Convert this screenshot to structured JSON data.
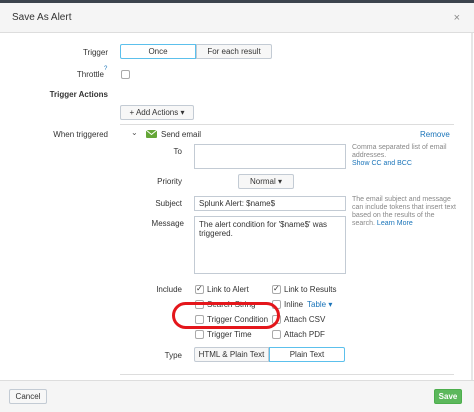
{
  "dialog": {
    "title": "Save As Alert",
    "close_label": "×"
  },
  "trigger": {
    "label": "Trigger",
    "options": [
      "Once",
      "For each result"
    ],
    "selected": "Once"
  },
  "throttle": {
    "label": "Throttle",
    "help_marker": "?"
  },
  "trigger_actions": {
    "heading": "Trigger Actions",
    "add_button": "+ Add Actions ▾"
  },
  "when_triggered": {
    "label": "When triggered",
    "action_name": "Send email",
    "remove_label": "Remove",
    "to": {
      "label": "To",
      "value": "",
      "help": "Comma separated list of email addresses.",
      "help_link": "Show CC and BCC"
    },
    "priority": {
      "label": "Priority",
      "value": "Normal ▾"
    },
    "subject": {
      "label": "Subject",
      "value": "Splunk Alert: $name$",
      "help": "The email subject and message can include tokens that insert text based on the results of the search.",
      "help_link": "Learn More"
    },
    "message": {
      "label": "Message",
      "value": "The alert condition for '$name$' was triggered."
    },
    "include": {
      "label": "Include",
      "items": [
        {
          "label": "Link to Alert",
          "checked": true
        },
        {
          "label": "Link to Results",
          "checked": true
        },
        {
          "label": "Search String",
          "checked": false
        },
        {
          "label": "Inline",
          "checked": false
        },
        {
          "label": "Trigger Condition",
          "checked": false
        },
        {
          "label": "Attach CSV",
          "checked": false
        },
        {
          "label": "Trigger Time",
          "checked": false
        },
        {
          "label": "Attach PDF",
          "checked": false
        }
      ],
      "inline_format": "Table ▾"
    },
    "type": {
      "label": "Type",
      "options": [
        "HTML & Plain Text",
        "Plain Text"
      ],
      "selected": "Plain Text"
    }
  },
  "footer": {
    "cancel_label": "Cancel",
    "save_label": "Save"
  },
  "colors": {
    "save_green": "#5cb85c",
    "link_blue": "#1a74b9",
    "highlight_red": "#e4161b",
    "email_icon_green": "#65a637"
  }
}
